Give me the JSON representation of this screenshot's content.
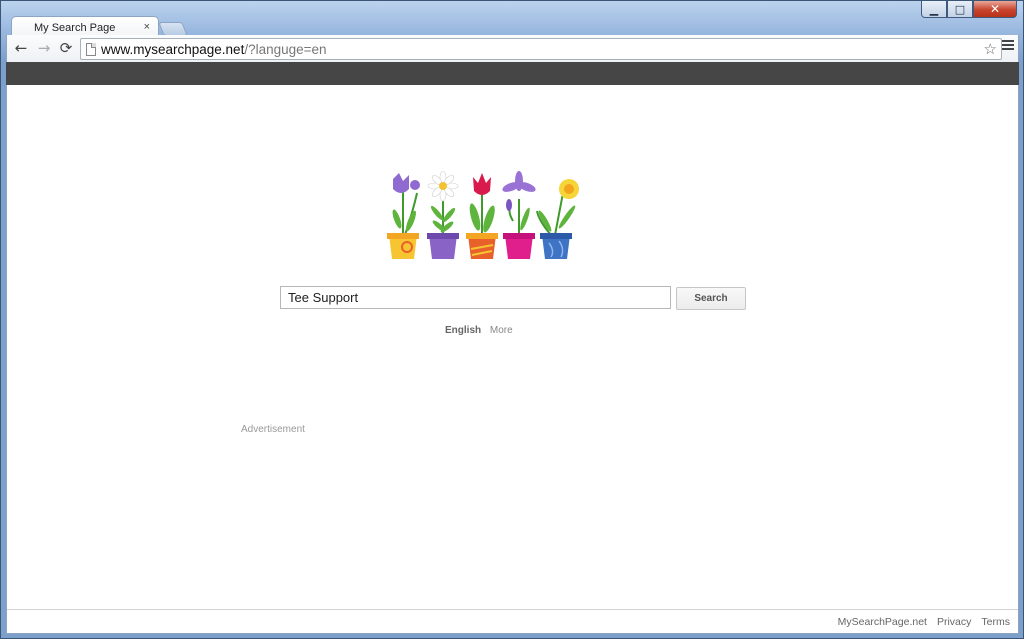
{
  "browser": {
    "tab_title": "My Search Page",
    "tab_close": "×",
    "url_host": "www.mysearchpage.net",
    "url_rest": "/?languge=en",
    "window_controls": {
      "minimize": "▁",
      "maximize": "□",
      "close": "✕"
    }
  },
  "icons": {
    "back": "arrow-left-icon",
    "forward": "arrow-right-icon",
    "reload": "reload-icon",
    "bookmark": "star-icon",
    "menu": "hamburger-menu-icon",
    "page": "page-icon"
  },
  "search": {
    "value": "Tee Support",
    "button_label": "Search"
  },
  "languages": {
    "current": "English",
    "more": "More"
  },
  "ad_label": "Advertisement",
  "footer": {
    "site": "MySearchPage.net",
    "privacy": "Privacy",
    "terms": "Terms"
  },
  "colors": {
    "topbar": "#464646",
    "pot_yellow": "#f7c531",
    "pot_purple": "#8a63c6",
    "pot_orange": "#e8612a",
    "pot_magenta": "#e01f8c",
    "pot_blue": "#3f73c4"
  }
}
